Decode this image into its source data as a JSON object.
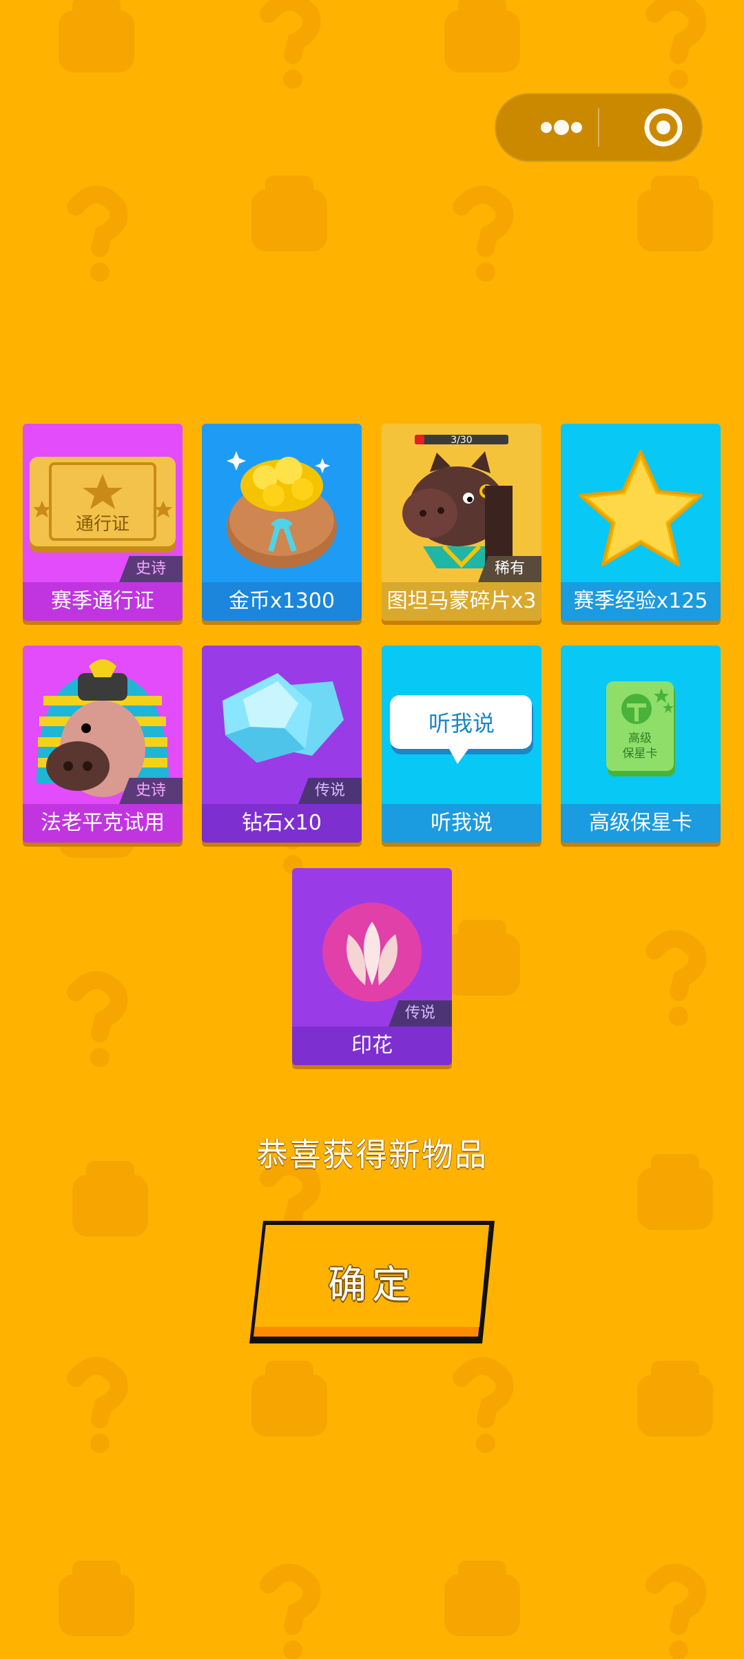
{
  "capsule": {
    "more_icon": "more-dots-icon",
    "close_icon": "target-close-icon"
  },
  "rewards": [
    {
      "name": "赛季通行证",
      "badge": "史诗",
      "icon": "pass-ticket-icon",
      "ticket_text": "通行证"
    },
    {
      "name": "金币x1300",
      "badge": "",
      "icon": "gold-coin-bag-icon"
    },
    {
      "name": "图坦马蒙碎片x3",
      "badge": "稀有",
      "icon": "horse-pharaoh-icon",
      "progress": "3/30"
    },
    {
      "name": "赛季经验x125",
      "badge": "",
      "icon": "star-icon"
    },
    {
      "name": "法老平克试用",
      "badge": "史诗",
      "icon": "pharaoh-pig-icon"
    },
    {
      "name": "钻石x10",
      "badge": "传说",
      "icon": "diamond-icon"
    },
    {
      "name": "听我说",
      "badge": "",
      "icon": "speech-bubble-icon",
      "bubble_text": "听我说"
    },
    {
      "name": "高级保星卡",
      "badge": "",
      "icon": "star-protect-card-icon",
      "card_text_1": "高级",
      "card_text_2": "保星卡"
    },
    {
      "name": "印花",
      "badge": "传说",
      "icon": "lotus-stamp-icon"
    }
  ],
  "message": "恭喜获得新物品",
  "confirm_label": "确定",
  "colors": {
    "background": "#ffb300",
    "epic": "#e04cff",
    "blue": "#1e9cf5",
    "cyan": "#08c8f5",
    "purple": "#9a3be8"
  }
}
